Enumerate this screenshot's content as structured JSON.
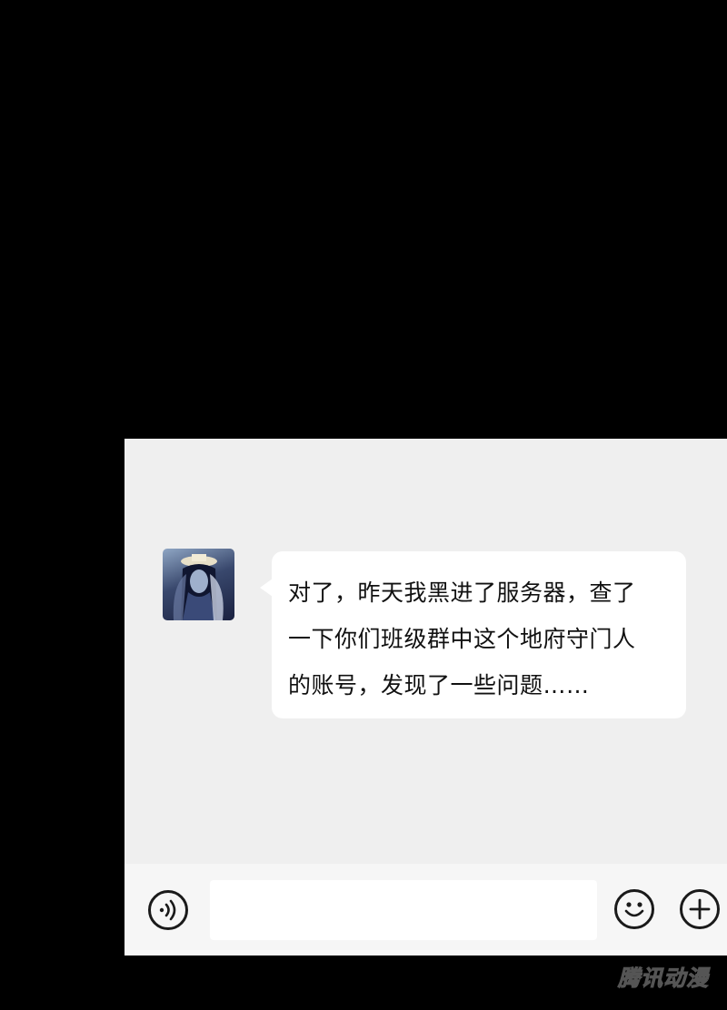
{
  "chat": {
    "avatar_icon": "character-portrait-avatar",
    "message": "对了，昨天我黑进了服务器，查了\n一下你们班级群中这个地府守门人\n的账号，发现了一些问题……"
  },
  "input_bar": {
    "voice_icon": "voice-icon",
    "text_value": "",
    "emoji_icon": "smile-emoji-icon",
    "plus_icon": "plus-icon"
  },
  "watermark": {
    "text": "腾讯动漫"
  },
  "colors": {
    "page_background": "#000000",
    "chat_background": "#efefef",
    "bubble": "#ffffff",
    "input_bar": "#f6f6f6",
    "icon": "#1a1a1a"
  }
}
